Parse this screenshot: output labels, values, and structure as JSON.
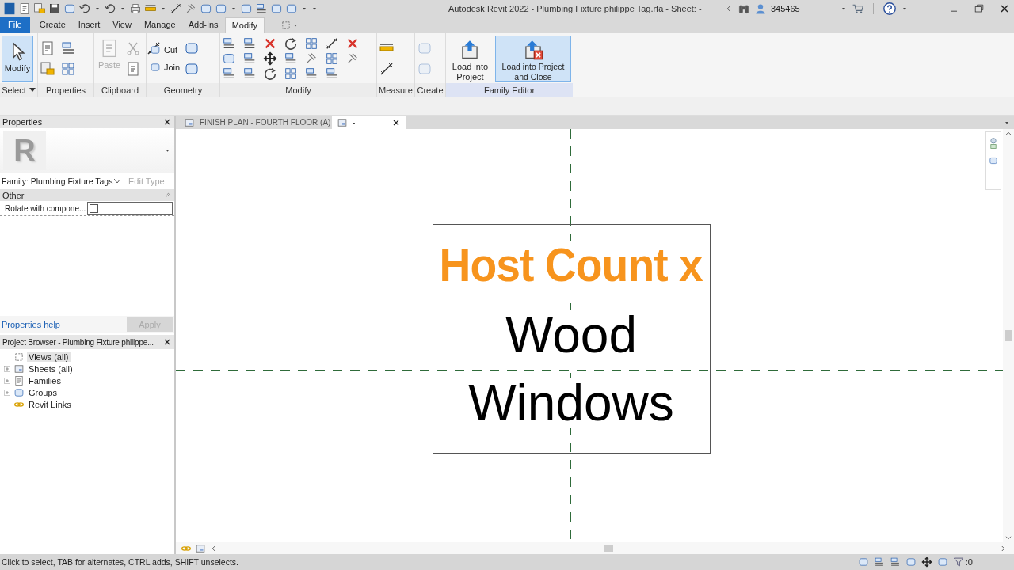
{
  "title_bar": {
    "title": "Autodesk Revit 2022 - Plumbing Fixture philippe Tag.rfa - Sheet:  -",
    "user": "345465"
  },
  "ribbon_tabs": [
    {
      "label": "File",
      "kind": "file",
      "selected": false
    },
    {
      "label": "Create",
      "kind": "tab",
      "selected": false
    },
    {
      "label": "Insert",
      "kind": "tab",
      "selected": false
    },
    {
      "label": "View",
      "kind": "tab",
      "selected": false
    },
    {
      "label": "Manage",
      "kind": "tab",
      "selected": false
    },
    {
      "label": "Add-Ins",
      "kind": "tab",
      "selected": false
    },
    {
      "label": "Modify",
      "kind": "tab",
      "selected": true
    }
  ],
  "ribbon_panels": [
    {
      "label": "Select",
      "dropdown": true,
      "highlighted": false,
      "buttons": [
        {
          "label": "Modify",
          "kind": "large",
          "active": true,
          "disabled": false
        }
      ]
    },
    {
      "label": "Properties",
      "dropdown": false,
      "highlighted": false
    },
    {
      "label": "Clipboard",
      "dropdown": false,
      "highlighted": false,
      "buttons": [
        {
          "label": "Paste",
          "kind": "large",
          "active": false,
          "disabled": true
        }
      ]
    },
    {
      "label": "Geometry",
      "dropdown": false,
      "highlighted": false,
      "buttons": [
        {
          "label": "Cut",
          "kind": "small",
          "active": false,
          "disabled": false
        },
        {
          "label": "Join",
          "kind": "small",
          "active": false,
          "disabled": false
        }
      ]
    },
    {
      "label": "Modify",
      "dropdown": false,
      "highlighted": false
    },
    {
      "label": "Measure",
      "dropdown": false,
      "highlighted": false
    },
    {
      "label": "Create",
      "dropdown": false,
      "highlighted": false
    },
    {
      "label": "Family Editor",
      "dropdown": false,
      "highlighted": true,
      "buttons": [
        {
          "label": "Load into Project",
          "kind": "large",
          "active": false,
          "disabled": false
        },
        {
          "label": "Load into Project and Close",
          "kind": "large",
          "active": true,
          "disabled": false
        }
      ]
    }
  ],
  "properties": {
    "title": "Properties",
    "preview": "R",
    "type_selector": "Family: Plumbing Fixture Tags",
    "edit_type": "Edit Type",
    "groups": [
      {
        "label": "Other",
        "rows": [
          {
            "label": "Rotate with compone...",
            "checked": false
          }
        ]
      }
    ],
    "help_link": "Properties help",
    "apply": "Apply"
  },
  "project_browser": {
    "title": "Project Browser - Plumbing Fixture philippe...",
    "items": [
      {
        "label": "Views (all)",
        "selected": true
      },
      {
        "label": "Sheets (all)",
        "selected": false,
        "expanded": false
      },
      {
        "label": "Families",
        "selected": false,
        "expanded": false
      },
      {
        "label": "Groups",
        "selected": false,
        "expanded": false
      },
      {
        "label": "Revit Links",
        "selected": false
      }
    ]
  },
  "view_tabs": [
    {
      "label": "FINISH PLAN - FOURTH FLOOR (A)",
      "selected": false
    },
    {
      "label": "-",
      "selected": true
    }
  ],
  "tag_labels": [
    {
      "text": "Host Count x",
      "color": "#f7941d"
    },
    {
      "text": "Wood",
      "color": "#000000"
    },
    {
      "text": "Windows",
      "color": "#000000"
    }
  ],
  "status_bar": {
    "message": "Click to select, TAB for alternates, CTRL adds, SHIFT unselects.",
    "selection_count": ":0"
  }
}
